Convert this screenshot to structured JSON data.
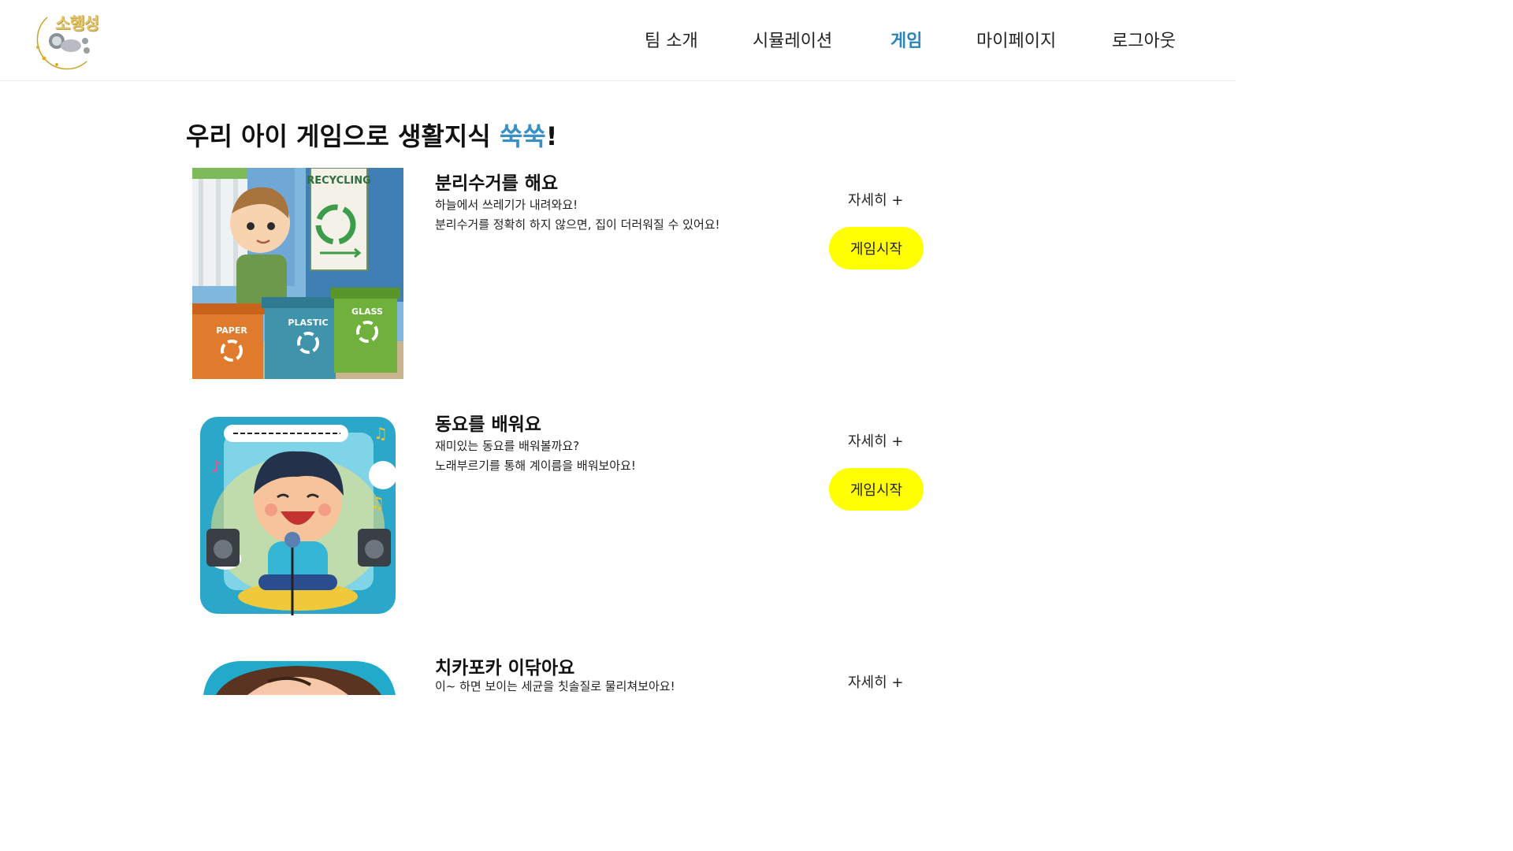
{
  "header": {
    "logo_text": "소행성",
    "nav": [
      {
        "label": "팀 소개",
        "active": false
      },
      {
        "label": "시뮬레이션",
        "active": false
      },
      {
        "label": "게임",
        "active": true
      },
      {
        "label": "마이페이지",
        "active": false
      },
      {
        "label": "로그아웃",
        "active": false
      }
    ]
  },
  "main": {
    "title_main": "우리 아이 게임으로 생활지식 ",
    "title_accent": "쑥쑥",
    "title_end": "!",
    "games": [
      {
        "title": "분리수거를 해요",
        "desc_line1": "하늘에서 쓰레기가 내려와요!",
        "desc_line2": "분리수거를 정확히 하지 않으면, 집이 더러워질 수 있어요!",
        "detail_label": "자세히 +",
        "start_label": "게임시작",
        "image": {
          "sign_text": "RECYCLING",
          "bins": [
            "PAPER",
            "PLASTIC",
            "GLASS"
          ]
        }
      },
      {
        "title": "동요를 배워요",
        "desc_line1": "재미있는 동요를 배워볼까요?",
        "desc_line2": "노래부르기를 통해 계이름을 배워보아요!",
        "detail_label": "자세히 +",
        "start_label": "게임시작"
      },
      {
        "title": "치카포카 이닦아요",
        "desc_line1": "이~ 하면 보이는 세균을 칫솔질로 물리쳐보아요!",
        "detail_label": "자세히 +"
      }
    ]
  },
  "colors": {
    "accent_blue": "#3a8fc4",
    "nav_active": "#2a86b8",
    "start_button": "#ffff00"
  }
}
